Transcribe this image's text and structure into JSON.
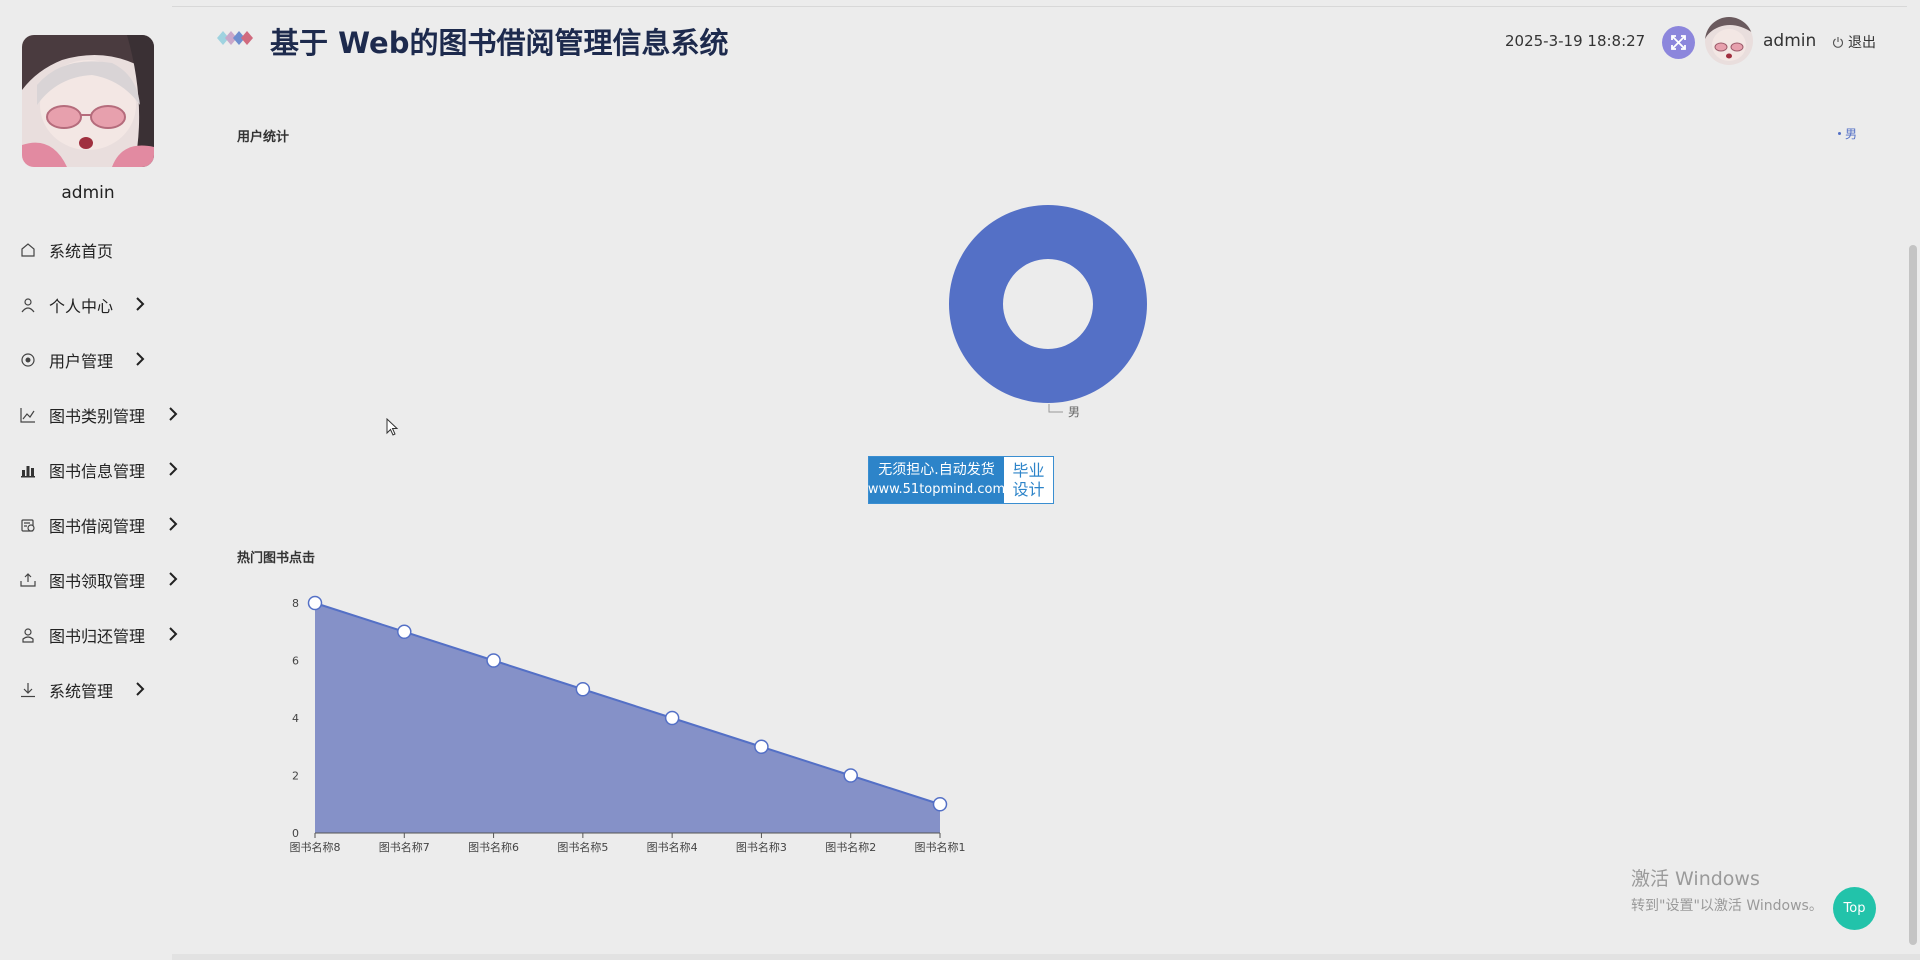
{
  "header": {
    "title": "基于 Web的图书借阅管理信息系统",
    "datetime": "2025-3-19 18:8:27",
    "username": "admin",
    "logout_label": "退出"
  },
  "sidebar": {
    "username": "admin",
    "items": [
      {
        "label": "系统首页",
        "icon": "home-icon",
        "has_arrow": false
      },
      {
        "label": "个人中心",
        "icon": "user-icon",
        "has_arrow": true
      },
      {
        "label": "用户管理",
        "icon": "target-icon",
        "has_arrow": true
      },
      {
        "label": "图书类别管理",
        "icon": "line-chart-icon",
        "has_arrow": true
      },
      {
        "label": "图书信息管理",
        "icon": "bar-chart-icon",
        "has_arrow": true
      },
      {
        "label": "图书借阅管理",
        "icon": "borrow-icon",
        "has_arrow": true
      },
      {
        "label": "图书领取管理",
        "icon": "inbox-icon",
        "has_arrow": true
      },
      {
        "label": "图书归还管理",
        "icon": "person-icon",
        "has_arrow": true
      },
      {
        "label": "系统管理",
        "icon": "download-icon",
        "has_arrow": true
      }
    ]
  },
  "sections": {
    "user_stats_title": "用户统计",
    "hot_books_title": "热门图书点击"
  },
  "banner": {
    "line1": "无须担心.自动发货",
    "line2": "www.51topmind.com",
    "right1": "毕业",
    "right2": "设计"
  },
  "watermark": {
    "line1": "激活 Windows",
    "line2": "转到\"设置\"以激活 Windows。"
  },
  "top_button_label": "Top",
  "colors": {
    "series": "#5470c6",
    "area_fill": "#8591c8",
    "title": "#1d2a4d",
    "top_button": "#22c3aa"
  },
  "chart_data": [
    {
      "type": "pie",
      "title": "用户统计",
      "legend": [
        "男"
      ],
      "legend_position": "top-right",
      "slices": [
        {
          "name": "男",
          "value": 1
        }
      ]
    },
    {
      "type": "area",
      "title": "热门图书点击",
      "categories": [
        "图书名称8",
        "图书名称7",
        "图书名称6",
        "图书名称5",
        "图书名称4",
        "图书名称3",
        "图书名称2",
        "图书名称1"
      ],
      "values": [
        8,
        7,
        6,
        5,
        4,
        3,
        2,
        1
      ],
      "ylim": [
        0,
        8
      ],
      "yticks": [
        0,
        2,
        4,
        6,
        8
      ],
      "grid": false
    }
  ]
}
